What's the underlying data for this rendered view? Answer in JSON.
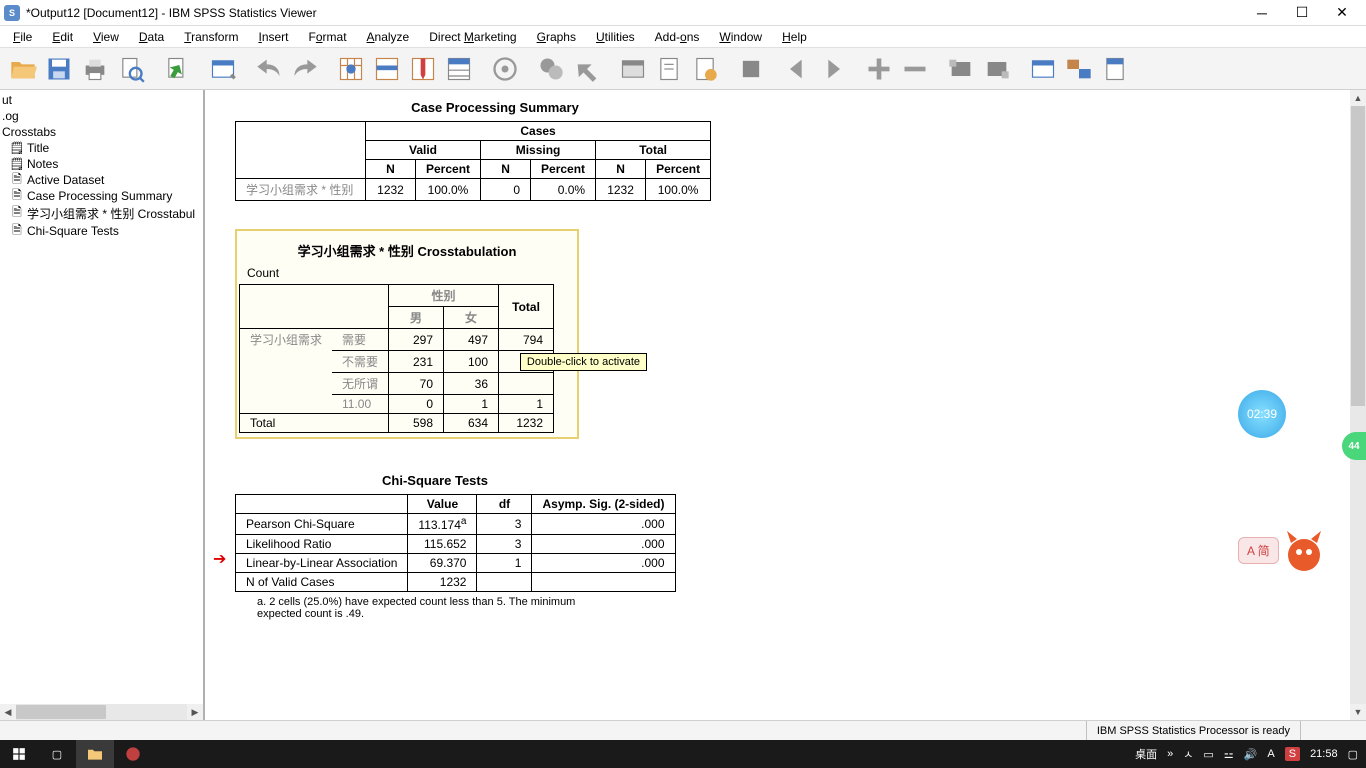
{
  "title": "*Output12 [Document12] - IBM SPSS Statistics Viewer",
  "menus": [
    "File",
    "Edit",
    "View",
    "Data",
    "Transform",
    "Insert",
    "Format",
    "Analyze",
    "Direct Marketing",
    "Graphs",
    "Utilities",
    "Add-ons",
    "Window",
    "Help"
  ],
  "outline": [
    "ut",
    ".og",
    "Crosstabs",
    "Title",
    "Notes",
    "Active Dataset",
    "Case Processing Summary",
    "学习小组需求 * 性别 Crosstabul",
    "Chi-Square Tests"
  ],
  "cps": {
    "title": "Case Processing Summary",
    "cases": "Cases",
    "cols": {
      "valid": "Valid",
      "missing": "Missing",
      "total": "Total",
      "n": "N",
      "percent": "Percent"
    },
    "rowlabel": "学习小组需求 * 性别",
    "valid_n": "1232",
    "valid_p": "100.0%",
    "miss_n": "0",
    "miss_p": "0.0%",
    "total_n": "1232",
    "total_p": "100.0%"
  },
  "ct": {
    "title": "学习小组需求 * 性别 Crosstabulation",
    "count": "Count",
    "col_group": "性别",
    "col_m": "男",
    "col_f": "女",
    "col_total": "Total",
    "row_group": "学习小组需求",
    "rows": [
      {
        "label": "需要",
        "m": "297",
        "f": "497",
        "t": "794"
      },
      {
        "label": "不需要",
        "m": "231",
        "f": "100",
        "t": ""
      },
      {
        "label": "无所谓",
        "m": "70",
        "f": "36",
        "t": ""
      },
      {
        "label": "11.00",
        "m": "0",
        "f": "1",
        "t": "1"
      }
    ],
    "total": {
      "label": "Total",
      "m": "598",
      "f": "634",
      "t": "1232"
    },
    "tooltip": "Double-click to activate"
  },
  "chi": {
    "title": "Chi-Square Tests",
    "cols": {
      "value": "Value",
      "df": "df",
      "asymp": "Asymp. Sig. (2-sided)"
    },
    "rows": [
      {
        "label": "Pearson Chi-Square",
        "value": "113.174",
        "sup": "a",
        "df": "3",
        "sig": ".000"
      },
      {
        "label": "Likelihood Ratio",
        "value": "115.652",
        "sup": "",
        "df": "3",
        "sig": ".000"
      },
      {
        "label": "Linear-by-Linear Association",
        "value": "69.370",
        "sup": "",
        "df": "1",
        "sig": ".000"
      },
      {
        "label": "N of Valid Cases",
        "value": "1232",
        "sup": "",
        "df": "",
        "sig": ""
      }
    ],
    "footnote": "a. 2 cells (25.0%) have expected count less than 5. The minimum expected count is .49."
  },
  "status": "IBM SPSS Statistics Processor is ready",
  "clock_widget": "02:39",
  "green_badge": "44",
  "ime": "A 简",
  "taskbar": {
    "desktop": "桌面",
    "time": "21:58"
  }
}
